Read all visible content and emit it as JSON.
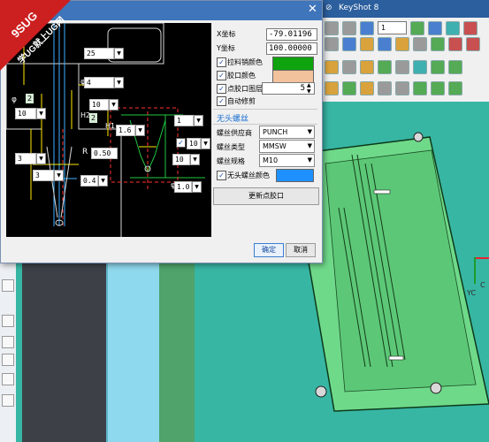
{
  "app": {
    "title_items": [
      "⊘",
      "KeyShot 8"
    ],
    "ribbon_combo": "1",
    "viewport_axis_label": "YC",
    "viewport_axis_label2": "C"
  },
  "dialog": {
    "close": "✕",
    "x_label": "X坐标",
    "x_value": "-79.01196",
    "y_label": "Y坐标",
    "y_value": "100.00000",
    "pull_pin_color_label": "拉料销颜色",
    "pull_pin_color": "#0fa30f",
    "gate_color_label": "胶口颜色",
    "gate_color": "#f2c29c",
    "gate_layer_label": "点胶口图层",
    "gate_layer_value": "5",
    "auto_trim_label": "自动修剪",
    "screw_section": "无头螺丝",
    "supplier_label": "螺丝供应商",
    "supplier_value": "PUNCH",
    "type_label": "螺丝类型",
    "type_value": "MMSW",
    "spec_label": "螺丝规格",
    "spec_value": "M10",
    "screw_color_label": "无头螺丝颜色",
    "screw_color": "#1e90ff",
    "update_button": "更新点胶口",
    "ok_button": "确定",
    "cancel_button": "取消"
  },
  "diagram": {
    "val_25": "25",
    "val_4": "4",
    "phi_sym": "φ",
    "val_2": "2",
    "val_10a": "10",
    "val_3a": "3",
    "val_3b": "3",
    "r_label": "R",
    "r_value": "0.50",
    "val_04": "0.4",
    "val_10b": "10",
    "val_2b": "2",
    "h2": "H2",
    "h1": "H1",
    "val_16": "1.6",
    "val_1": "1",
    "val_10c": "10",
    "val_10d": "10",
    "val_10e": "1.0",
    "chk_mark": "✓"
  },
  "watermark": {
    "line1": "9SUG",
    "line2": "学UG就上UG网"
  }
}
